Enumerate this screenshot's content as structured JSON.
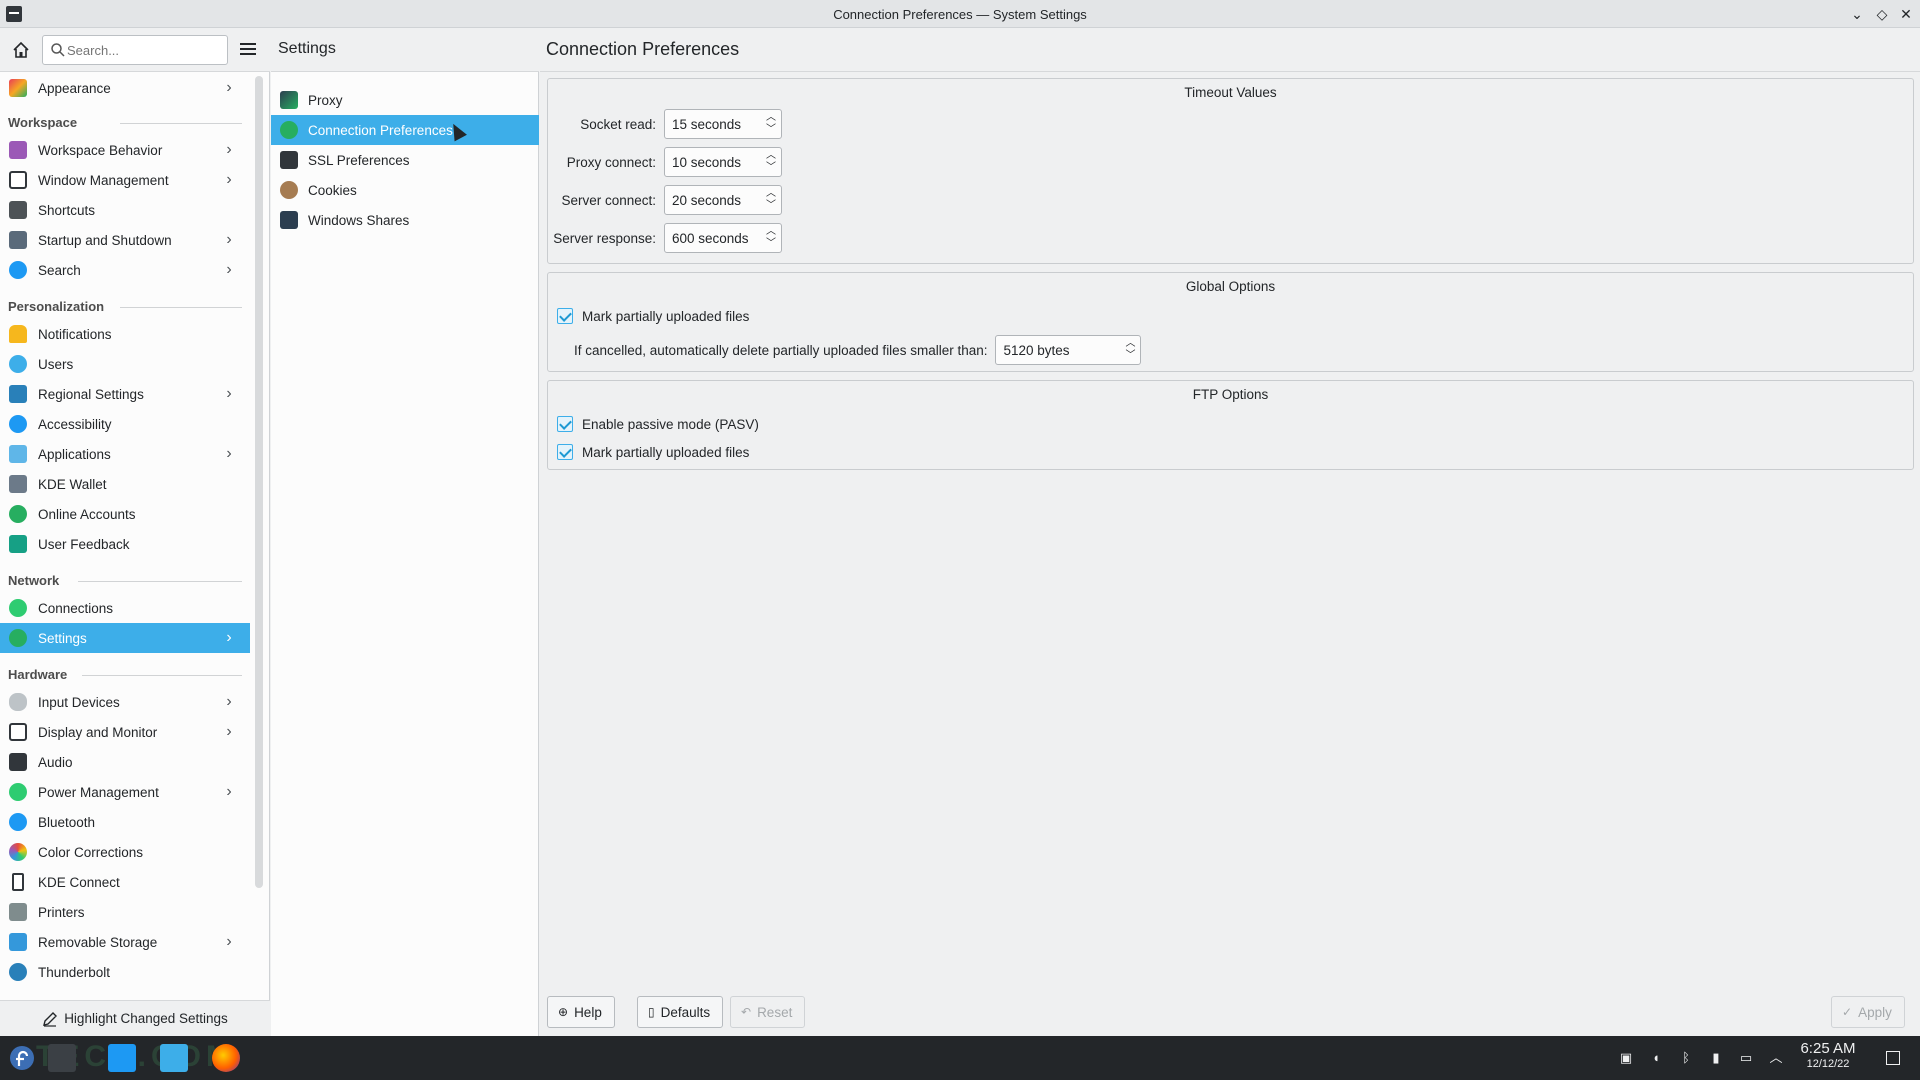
{
  "window": {
    "title": "Connection Preferences — System Settings"
  },
  "search": {
    "placeholder": "Search..."
  },
  "sidebar": {
    "top_item": {
      "label": "Appearance",
      "icon": "appearance-icon",
      "has_children": true
    },
    "categories": [
      {
        "label": "Workspace",
        "items": [
          {
            "label": "Workspace Behavior",
            "icon": "workspace-behavior-icon",
            "has_children": true
          },
          {
            "label": "Window Management",
            "icon": "window-management-icon",
            "has_children": true
          },
          {
            "label": "Shortcuts",
            "icon": "keyboard-icon",
            "has_children": false
          },
          {
            "label": "Startup and Shutdown",
            "icon": "startup-icon",
            "has_children": true
          },
          {
            "label": "Search",
            "icon": "search-icon",
            "has_children": true
          }
        ]
      },
      {
        "label": "Personalization",
        "items": [
          {
            "label": "Notifications",
            "icon": "bell-icon",
            "has_children": false
          },
          {
            "label": "Users",
            "icon": "user-icon",
            "has_children": false
          },
          {
            "label": "Regional Settings",
            "icon": "regional-icon",
            "has_children": true
          },
          {
            "label": "Accessibility",
            "icon": "accessibility-icon",
            "has_children": false
          },
          {
            "label": "Applications",
            "icon": "applications-icon",
            "has_children": true
          },
          {
            "label": "KDE Wallet",
            "icon": "wallet-icon",
            "has_children": false
          },
          {
            "label": "Online Accounts",
            "icon": "online-accounts-icon",
            "has_children": false
          },
          {
            "label": "User Feedback",
            "icon": "feedback-icon",
            "has_children": false
          }
        ]
      },
      {
        "label": "Network",
        "items": [
          {
            "label": "Connections",
            "icon": "globe-icon",
            "has_children": false
          },
          {
            "label": "Settings",
            "icon": "network-settings-icon",
            "has_children": true,
            "active": true
          }
        ]
      },
      {
        "label": "Hardware",
        "items": [
          {
            "label": "Input Devices",
            "icon": "mouse-icon",
            "has_children": true
          },
          {
            "label": "Display and Monitor",
            "icon": "monitor-icon",
            "has_children": true
          },
          {
            "label": "Audio",
            "icon": "speaker-icon",
            "has_children": false
          },
          {
            "label": "Power Management",
            "icon": "power-icon",
            "has_children": true
          },
          {
            "label": "Bluetooth",
            "icon": "bluetooth-icon",
            "has_children": false
          },
          {
            "label": "Color Corrections",
            "icon": "color-icon",
            "has_children": false
          },
          {
            "label": "KDE Connect",
            "icon": "phone-icon",
            "has_children": false
          },
          {
            "label": "Printers",
            "icon": "printer-icon",
            "has_children": false
          },
          {
            "label": "Removable Storage",
            "icon": "usb-icon",
            "has_children": true
          },
          {
            "label": "Thunderbolt",
            "icon": "thunderbolt-icon",
            "has_children": false
          }
        ]
      }
    ],
    "highlight_button": "Highlight Changed Settings"
  },
  "middle": {
    "title": "Settings",
    "items": [
      {
        "label": "Proxy",
        "icon": "proxy-icon"
      },
      {
        "label": "Connection Preferences",
        "icon": "connection-icon",
        "active": true
      },
      {
        "label": "SSL Preferences",
        "icon": "ssl-icon"
      },
      {
        "label": "Cookies",
        "icon": "cookie-icon"
      },
      {
        "label": "Windows Shares",
        "icon": "shares-icon"
      }
    ]
  },
  "main": {
    "title": "Connection Preferences",
    "timeout": {
      "title": "Timeout Values",
      "fields": [
        {
          "label": "Socket read:",
          "value": "15 seconds"
        },
        {
          "label": "Proxy connect:",
          "value": "10 seconds"
        },
        {
          "label": "Server connect:",
          "value": "20 seconds"
        },
        {
          "label": "Server response:",
          "value": "600 seconds"
        }
      ]
    },
    "global": {
      "title": "Global Options",
      "mark_partial": "Mark partially uploaded files",
      "delete_label": "If cancelled, automatically delete partially uploaded files smaller than:",
      "delete_value": "5120 bytes"
    },
    "ftp": {
      "title": "FTP Options",
      "passive": "Enable passive mode (PASV)",
      "mark_partial": "Mark partially uploaded files"
    },
    "buttons": {
      "help": "Help",
      "defaults": "Defaults",
      "reset": "Reset",
      "apply": "Apply"
    }
  },
  "taskbar": {
    "time": "6:25 AM",
    "date": "12/12/22",
    "watermark": "TECH.COM"
  },
  "colors": {
    "accent": "#3daee9",
    "panel": "#eff0f1",
    "taskbar": "#232629"
  }
}
